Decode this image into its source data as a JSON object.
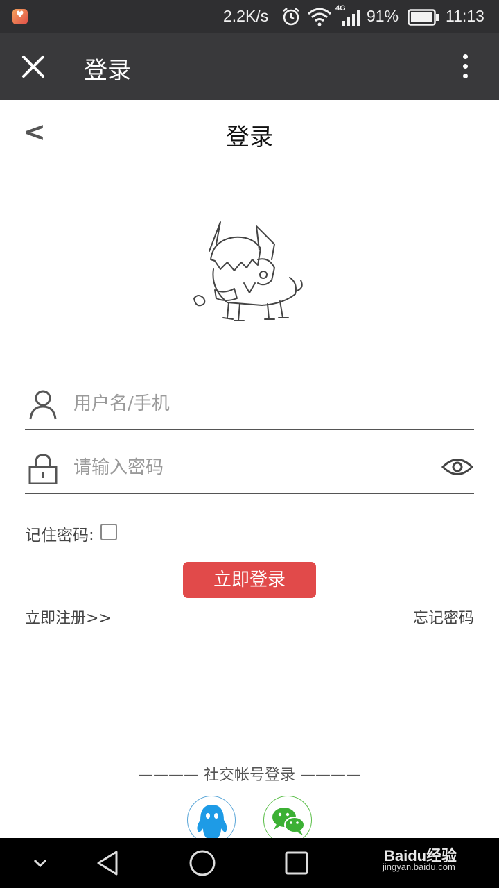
{
  "status_bar": {
    "network_speed": "2.2K/s",
    "network_type": "4G",
    "battery": "91%",
    "time": "11:13",
    "icons": [
      "app-notification-icon",
      "alarm-icon",
      "wifi-icon",
      "signal-icon",
      "battery-icon"
    ]
  },
  "app_bar": {
    "title": "登录",
    "close_icon": "close-icon",
    "more_icon": "more-vertical-icon"
  },
  "page": {
    "back_label": "<",
    "title": "登录"
  },
  "form": {
    "username_placeholder": "用户名/手机",
    "password_placeholder": "请输入密码",
    "remember_label": "记住密码:",
    "remember_checked": false,
    "login_button": "立即登录",
    "register_link": "立即注册>>",
    "forgot_link": "忘记密码"
  },
  "social": {
    "title": "———— 社交帐号登录 ————",
    "providers": [
      "qq-icon",
      "wechat-icon"
    ]
  },
  "nav_bar": {
    "icons": [
      "hide-keyboard-icon",
      "back-triangle-icon",
      "home-circle-icon",
      "recents-square-icon"
    ]
  },
  "watermark": {
    "brand": "Baidu经验",
    "url": "jingyan.baidu.com"
  },
  "colors": {
    "status_bar": "#2f2f31",
    "app_bar": "#39393b",
    "accent": "#e14a4a",
    "qq": "#1e9be6",
    "wechat": "#3cb034"
  }
}
